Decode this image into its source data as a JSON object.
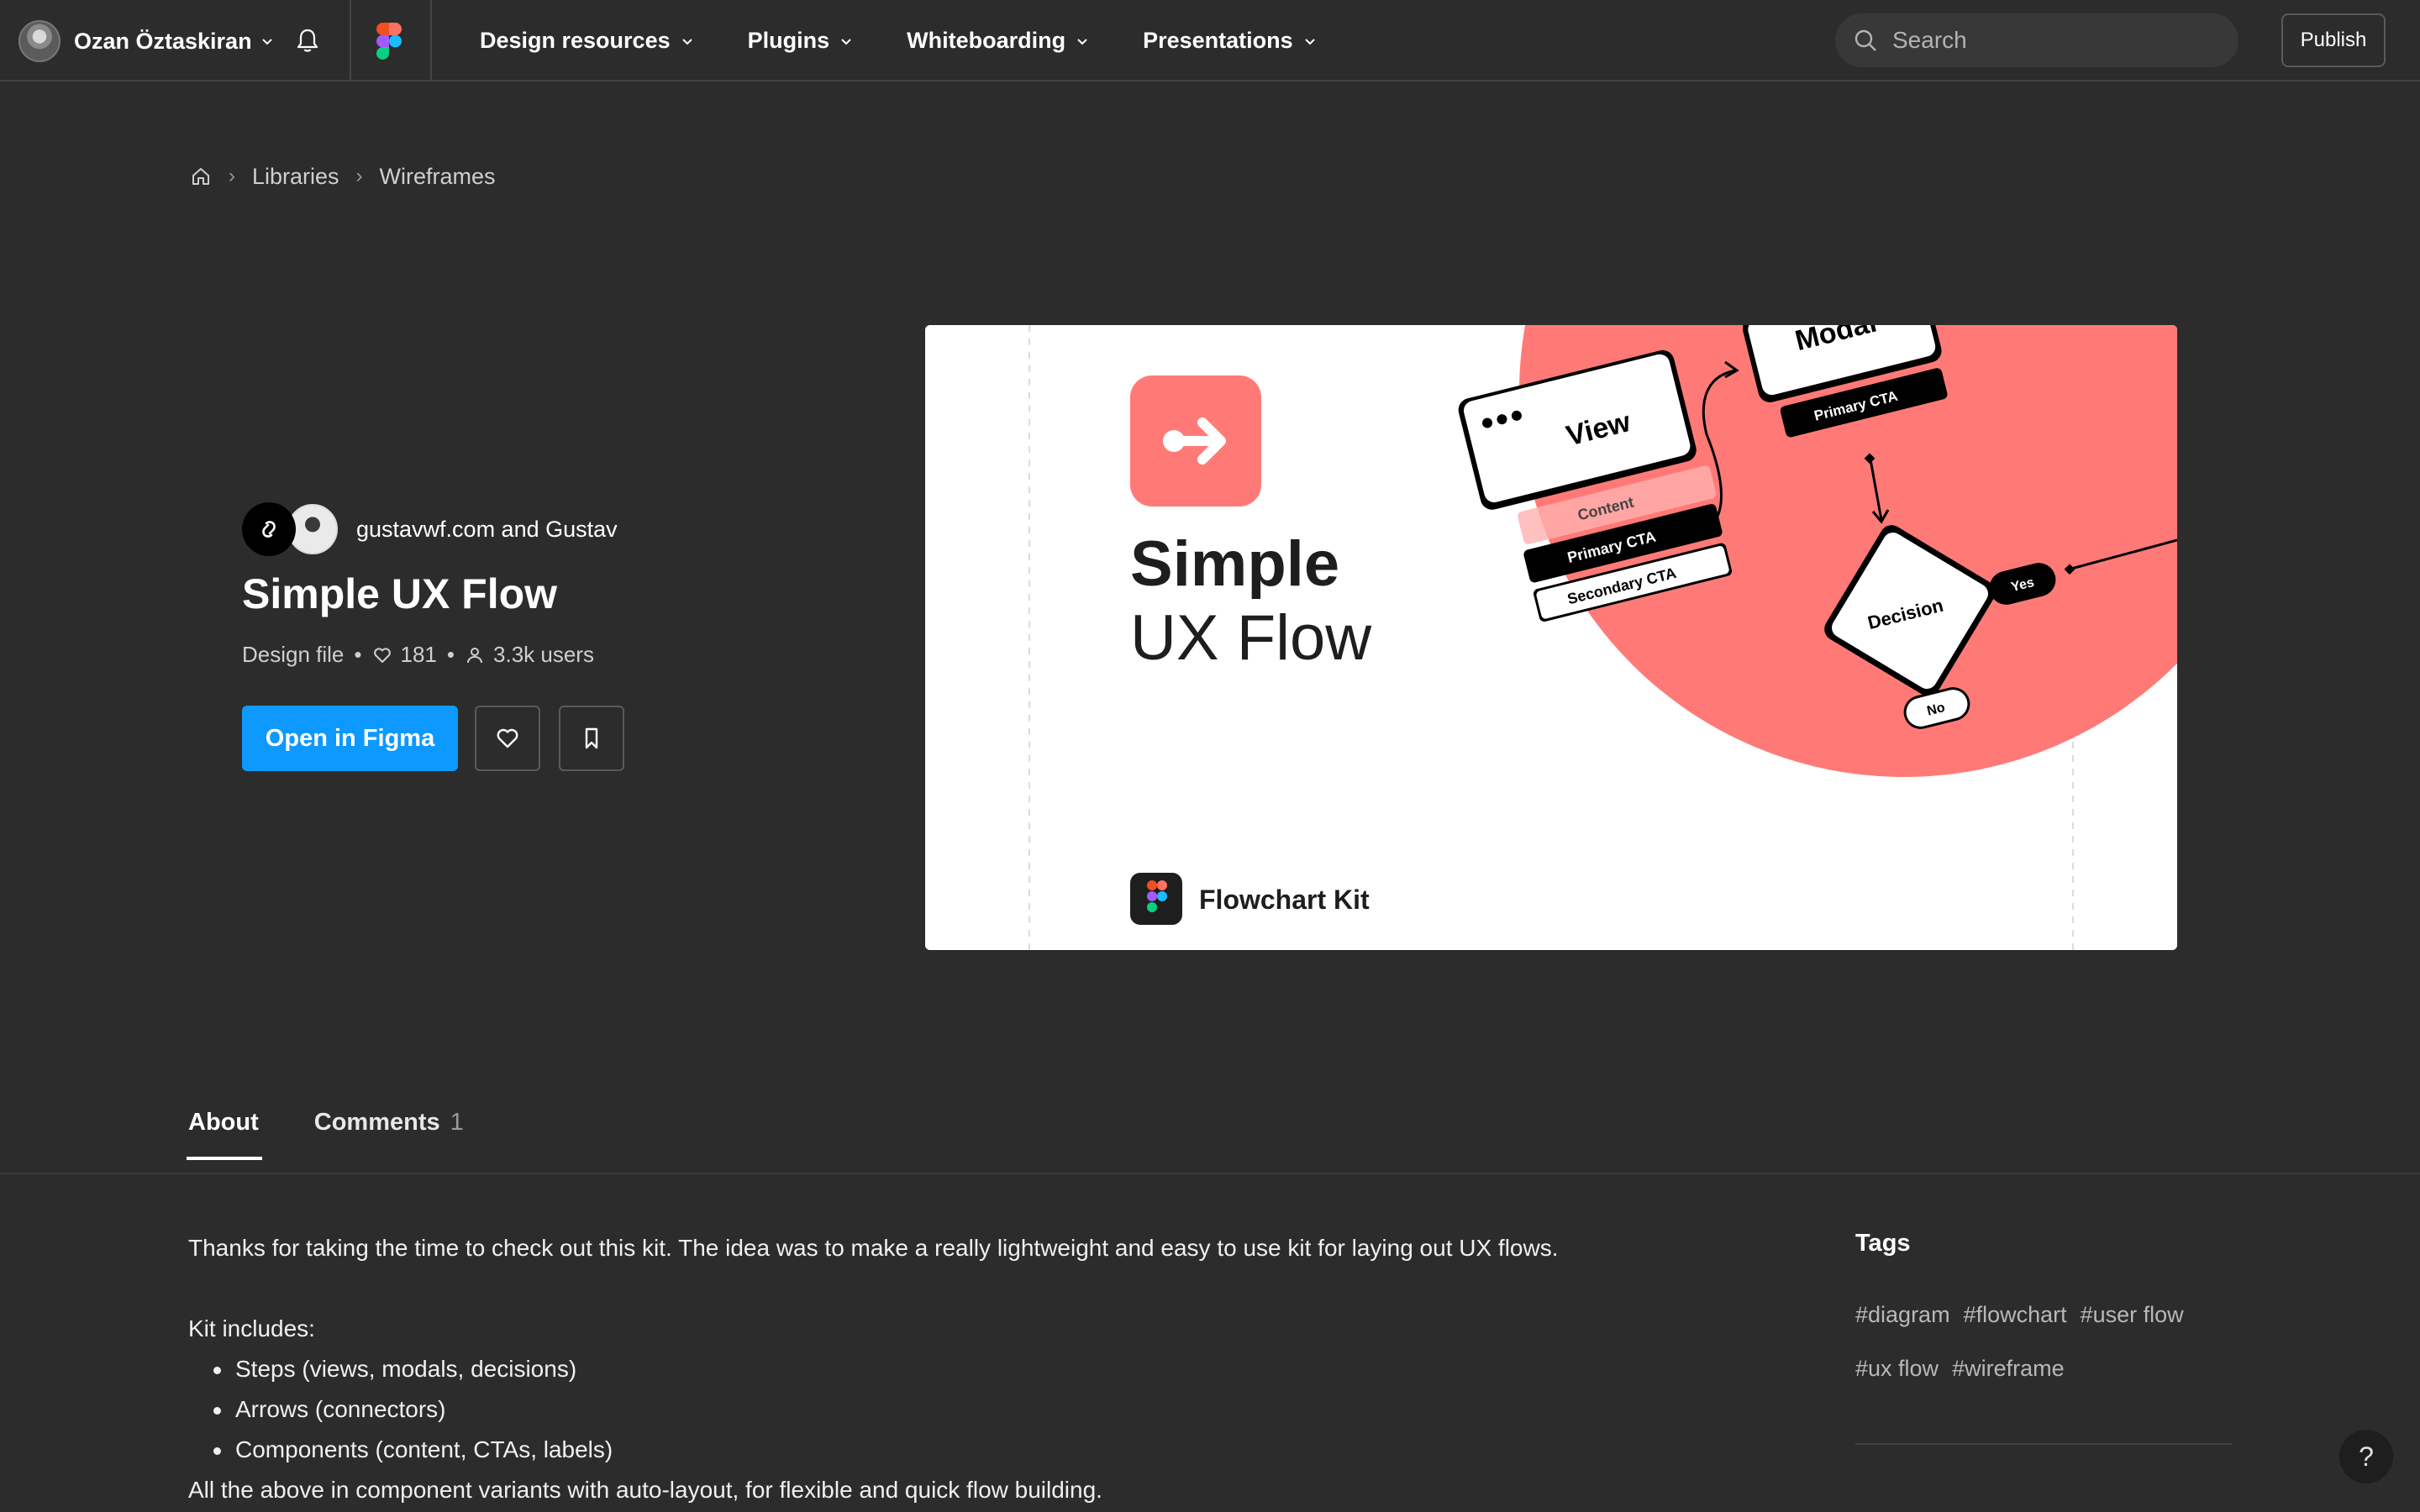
{
  "topbar": {
    "user_name": "Ozan Öztaskiran",
    "nav": [
      {
        "label": "Design resources"
      },
      {
        "label": "Plugins"
      },
      {
        "label": "Whiteboarding"
      },
      {
        "label": "Presentations"
      }
    ],
    "search_placeholder": "Search",
    "publish_label": "Publish"
  },
  "breadcrumb": {
    "items": [
      "Libraries",
      "Wireframes"
    ]
  },
  "file": {
    "authors": "gustavwf.com and Gustav",
    "title": "Simple UX Flow",
    "type": "Design file",
    "likes": "181",
    "users": "3.3k users",
    "open_label": "Open in Figma"
  },
  "preview": {
    "title_line1": "Simple",
    "title_line2": "UX Flow",
    "kit_name": "Flowchart Kit",
    "labels": {
      "view": "View",
      "modal": "Modal",
      "content": "Content",
      "primary_cta": "Primary CTA",
      "secondary_cta": "Secondary CTA",
      "decision": "Decision",
      "yes": "Yes",
      "no": "No"
    },
    "accent_color": "#ff7a77"
  },
  "tabs": [
    {
      "label": "About",
      "count": ""
    },
    {
      "label": "Comments",
      "count": "1"
    }
  ],
  "about": {
    "intro": "Thanks for taking the time to check out this kit. The idea was to make a really lightweight and easy to use kit for laying out UX flows.",
    "includes_heading": "Kit includes:",
    "bullets": [
      "Steps (views, modals, decisions)",
      "Arrows (connectors)",
      "Components (content, CTAs, labels)"
    ],
    "outro": "All the above in component variants with auto-layout, for flexible and quick flow building."
  },
  "tags": {
    "title": "Tags",
    "items": [
      "#diagram",
      "#flowchart",
      "#user flow",
      "#ux flow",
      "#wireframe"
    ]
  },
  "help_label": "?",
  "colors": {
    "background": "#2c2c2c",
    "primary_button": "#0d99ff"
  }
}
